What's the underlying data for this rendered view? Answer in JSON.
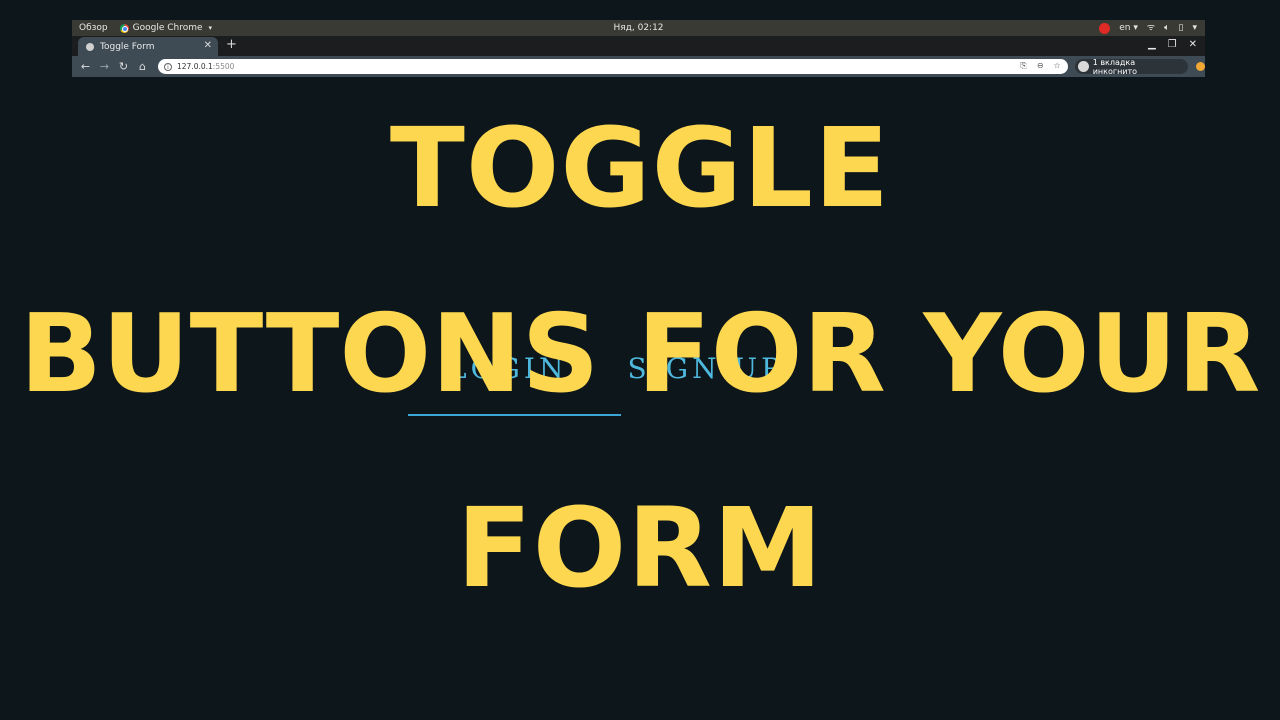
{
  "os_bar": {
    "overview_label": "Обзор",
    "app_label": "Google Chrome",
    "clock": "Няд, 02:12",
    "lang": "en",
    "icons": [
      "record-icon",
      "network-icon",
      "volume-icon",
      "battery-icon",
      "system-menu-icon"
    ]
  },
  "browser": {
    "tab_title": "Toggle Form",
    "new_tab_symbol": "+",
    "url_host": "127.0.0.1",
    "url_port": ":5500",
    "incognito_label": "1 вкладка инкогнито"
  },
  "page": {
    "form_tabs": [
      "LOGIN",
      "SIGN UP"
    ],
    "headline": [
      "TOGGLE",
      "BUTTONS FOR YOUR",
      "FORM"
    ],
    "colors": {
      "background": "#0c161b",
      "headline": "#fdd74f",
      "accent": "#4fb9dd"
    }
  }
}
